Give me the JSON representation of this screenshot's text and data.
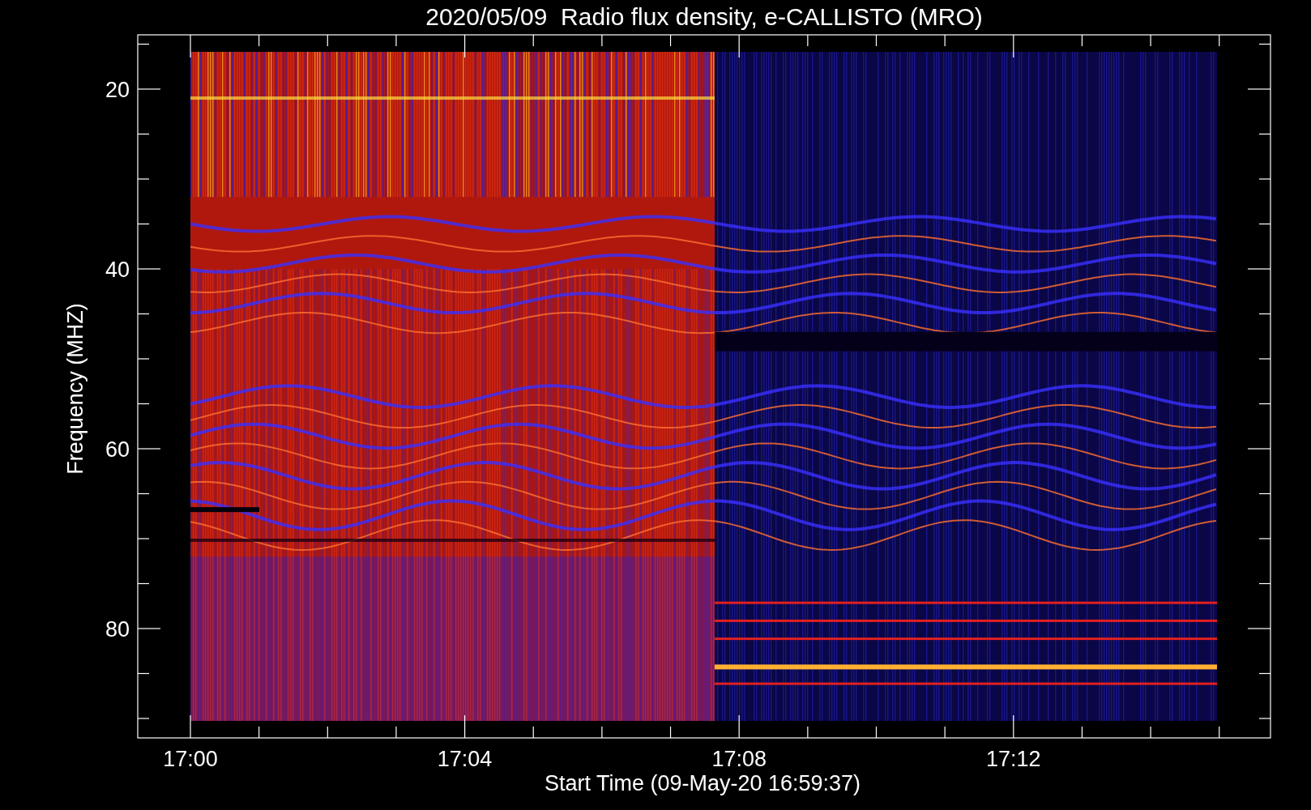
{
  "title": "2020/05/09  Radio flux density, e-CALLISTO (MRO)",
  "y_axis": {
    "label": "Frequency (MHZ)",
    "ticks": [
      "20",
      "40",
      "60",
      "80"
    ]
  },
  "x_axis": {
    "label": "Start Time (09-May-20 16:59:37)",
    "ticks": [
      "17:00",
      "17:04",
      "17:08",
      "17:12"
    ]
  }
}
